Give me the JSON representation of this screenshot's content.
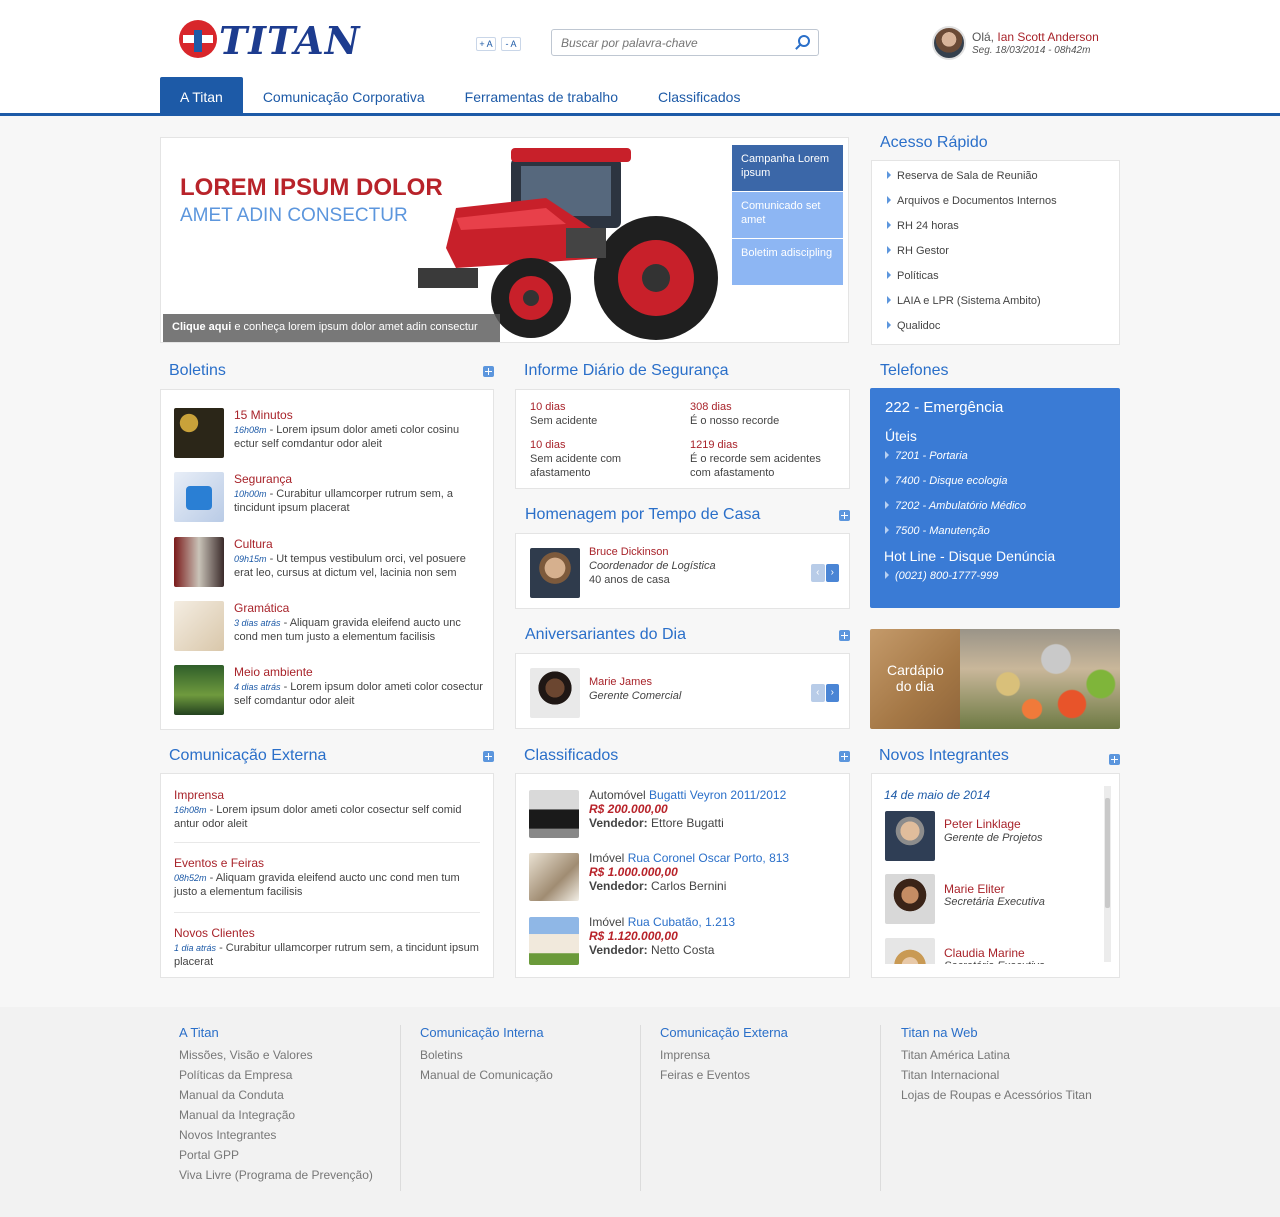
{
  "header": {
    "logo_text": "TITAN",
    "font_increase": "+ A",
    "font_decrease": "- A",
    "search_placeholder": "Buscar por palavra-chave",
    "greeting": "Olá,",
    "user_name": "Ian Scott Anderson",
    "date": "Seg. 18/03/2014 - 08h42m"
  },
  "nav": [
    {
      "label": "A Titan",
      "active": true
    },
    {
      "label": "Comunicação Corporativa",
      "active": false
    },
    {
      "label": "Ferramentas de trabalho",
      "active": false
    },
    {
      "label": "Classificados",
      "active": false
    }
  ],
  "hero": {
    "title": "LOREM IPSUM DOLOR",
    "subtitle": "AMET ADIN CONSECTUR",
    "caption_bold": "Clique aqui",
    "caption_rest": " e conheça lorem ipsum dolor amet adin consectur",
    "tabs": [
      {
        "label": "Campanha Lorem ipsum",
        "color": "#3b67a8"
      },
      {
        "label": "Comunicado set amet",
        "color": "#8db6f3"
      },
      {
        "label": "Boletim adiscipling",
        "color": "#8db6f3"
      }
    ]
  },
  "acesso_rapido": {
    "title": "Acesso Rápido",
    "items": [
      "Reserva de Sala de Reunião",
      "Arquivos e Documentos Internos",
      "RH 24 horas",
      "RH Gestor",
      "Políticas",
      "LAIA e LPR (Sistema Ambito)",
      "Qualidoc"
    ]
  },
  "boletins": {
    "title": "Boletins",
    "items": [
      {
        "title": "15 Minutos",
        "time": "16h08m",
        "text": " - Lorem ipsum dolor ameti color cosinu ectur self comdantur odor aleit"
      },
      {
        "title": "Segurança",
        "time": "10h00m",
        "text": " - Curabitur ullamcorper rutrum sem, a tincidunt ipsum placerat"
      },
      {
        "title": "Cultura",
        "time": "09h15m",
        "text": " - Ut tempus vestibulum orci, vel posuere erat leo, cursus at dictum vel, lacinia non sem"
      },
      {
        "title": "Gramática",
        "time": "3 dias atrás",
        "text": " - Aliquam gravida eleifend aucto unc cond men tum justo a elementum facilisis"
      },
      {
        "title": "Meio ambiente",
        "time": "4 dias atrás",
        "text": " - Lorem ipsum dolor ameti color cosectur self comdantur odor aleit"
      }
    ]
  },
  "informe": {
    "title": "Informe Diário de Segurança",
    "stats": [
      {
        "value": "10 dias",
        "label": "Sem acidente"
      },
      {
        "value": "308 dias",
        "label": "É o nosso recorde"
      },
      {
        "value": "10 dias",
        "label": "Sem acidente com afastamento"
      },
      {
        "value": "1219 dias",
        "label": "É o recorde sem acidentes com afastamento"
      }
    ]
  },
  "homenagem": {
    "title": "Homenagem por Tempo de Casa",
    "name": "Bruce Dickinson",
    "role": "Coordenador de Logística",
    "years": "40 anos de casa"
  },
  "aniversariantes": {
    "title": "Aniversariantes do Dia",
    "name": "Marie James",
    "role": "Gerente Comercial"
  },
  "telefones": {
    "title": "Telefones",
    "emergency": "222 - Emergência",
    "uteis_label": "Úteis",
    "uteis": [
      "7201 - Portaria",
      "7400 - Disque ecologia",
      "7202 - Ambulatório Médico",
      "7500 - Manutenção"
    ],
    "hotline_label": "Hot Line - Disque Denúncia",
    "hotline": "(0021) 800-1777-999"
  },
  "cardapio": {
    "label": "Cardápio do dia"
  },
  "comunicacao_externa": {
    "title": "Comunicação Externa",
    "items": [
      {
        "title": "Imprensa",
        "time": "16h08m",
        "text": " - Lorem ipsum dolor ameti color cosectur self comid antur odor aleit"
      },
      {
        "title": "Eventos e Feiras",
        "time": "08h52m",
        "text": " - Aliquam gravida eleifend aucto unc cond men tum justo a elementum facilisis"
      },
      {
        "title": "Novos Clientes",
        "time": "1 dia atrás",
        "text": " - Curabitur ullamcorper rutrum sem, a tincidunt ipsum placerat"
      }
    ]
  },
  "classificados": {
    "title": "Classificados",
    "seller_label": "Vendedor:",
    "items": [
      {
        "category": "Automóvel",
        "item": "Bugatti Veyron 2011/2012",
        "price": "R$ 200.000,00",
        "seller": "Ettore Bugatti"
      },
      {
        "category": "Imóvel",
        "item": "Rua Coronel Oscar Porto, 813",
        "price": "R$ 1.000.000,00",
        "seller": "Carlos Bernini"
      },
      {
        "category": "Imóvel",
        "item": "Rua Cubatão, 1.213",
        "price": "R$ 1.120.000,00",
        "seller": "Netto Costa"
      }
    ]
  },
  "novos_integrantes": {
    "title": "Novos Integrantes",
    "date": "14 de maio de 2014",
    "people": [
      {
        "name": "Peter Linklage",
        "role": "Gerente de Projetos"
      },
      {
        "name": "Marie Eliter",
        "role": "Secretária Executiva"
      },
      {
        "name": "Claudia Marine",
        "role": "Secretária Executiva"
      }
    ]
  },
  "footer": {
    "columns": [
      {
        "title": "A Titan",
        "links": [
          "Missões, Visão e Valores",
          "Políticas da Empresa",
          "Manual da Conduta",
          "Manual da Integração",
          "Novos Integrantes",
          "Portal GPP",
          "Viva Livre (Programa de Prevenção)"
        ]
      },
      {
        "title": "Comunicação Interna",
        "links": [
          "Boletins",
          "Manual de Comunicação"
        ]
      },
      {
        "title": "Comunicação Externa",
        "links": [
          "Imprensa",
          "Feiras e Eventos"
        ]
      },
      {
        "title": "Titan na Web",
        "links": [
          "Titan América Latina",
          "Titan Internacional",
          "Lojas de Roupas e Acessórios Titan"
        ]
      }
    ]
  }
}
